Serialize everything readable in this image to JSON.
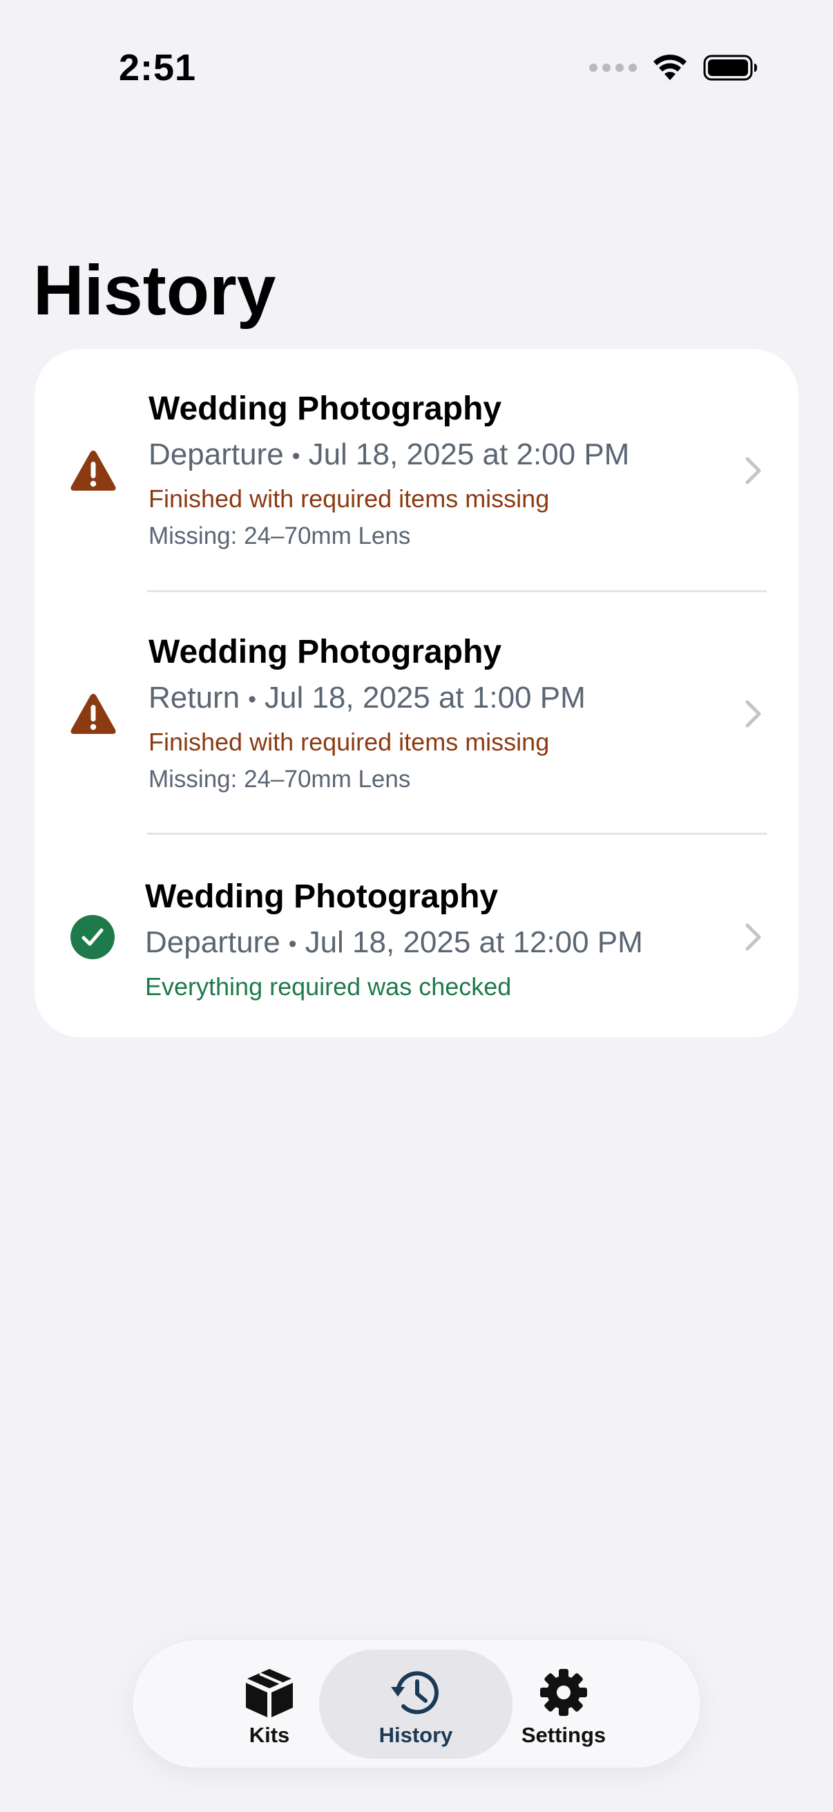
{
  "status_bar": {
    "time": "2:51"
  },
  "page": {
    "title": "History"
  },
  "history": [
    {
      "title": "Wedding Photography",
      "type": "Departure",
      "separator": "•",
      "datetime": "Jul 18, 2025 at 2:00 PM",
      "status": "Finished with required items missing",
      "status_kind": "warning",
      "missing": "Missing: 24–70mm Lens",
      "icon": "warning-triangle-icon"
    },
    {
      "title": "Wedding Photography",
      "type": "Return",
      "separator": "•",
      "datetime": "Jul 18, 2025 at 1:00 PM",
      "status": "Finished with required items missing",
      "status_kind": "warning",
      "missing": "Missing: 24–70mm Lens",
      "icon": "warning-triangle-icon"
    },
    {
      "title": "Wedding Photography",
      "type": "Departure",
      "separator": "•",
      "datetime": "Jul 18, 2025 at 12:00 PM",
      "status": "Everything required was checked",
      "status_kind": "success",
      "icon": "checkmark-circle-icon"
    }
  ],
  "tab_bar": {
    "kits": {
      "label": "Kits",
      "icon": "box-icon"
    },
    "history": {
      "label": "History",
      "icon": "clock-history-icon",
      "selected": true
    },
    "settings": {
      "label": "Settings",
      "icon": "gear-icon"
    }
  },
  "colors": {
    "background": "#f2f2f7",
    "warning": "#8b3a12",
    "success": "#1e7a4a",
    "secondary_text": "#5b6673",
    "active_tab": "#1c3a55"
  }
}
